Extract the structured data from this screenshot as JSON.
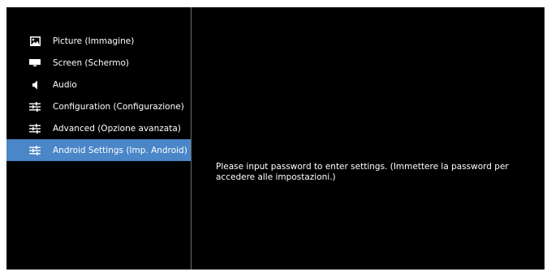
{
  "menu": {
    "items": [
      {
        "label": "Picture (Immagine)",
        "icon": "picture-icon",
        "selected": false
      },
      {
        "label": "Screen (Schermo)",
        "icon": "screen-icon",
        "selected": false
      },
      {
        "label": "Audio",
        "icon": "speaker-icon",
        "selected": false
      },
      {
        "label": "Configuration (Configurazione)",
        "icon": "sliders-icon",
        "selected": false
      },
      {
        "label": "Advanced (Opzione avanzata)",
        "icon": "sliders-icon",
        "selected": false
      },
      {
        "label": "Android Settings (Imp. Android)",
        "icon": "sliders-icon",
        "selected": true
      }
    ]
  },
  "content": {
    "message": "Please input password to enter settings. (Immettere la password per accedere alle impostazioni.)"
  },
  "colors": {
    "background": "#000000",
    "selected": "#4a86c8",
    "text": "#ffffff",
    "divider": "#6e6e6e"
  }
}
